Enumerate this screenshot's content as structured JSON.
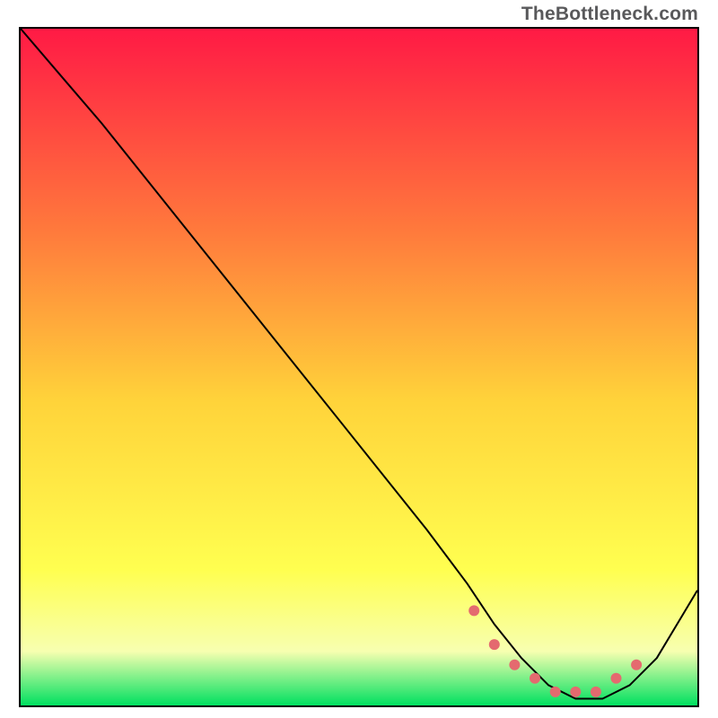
{
  "attribution": "TheBottleneck.com",
  "colors": {
    "gradient_top": "#ff1a45",
    "gradient_mid_upper": "#ff7a3c",
    "gradient_mid": "#ffd33a",
    "gradient_mid_lower": "#ffff50",
    "gradient_lower": "#f7ffb0",
    "gradient_bottom": "#00e060",
    "curve": "#000000",
    "marker": "#e46a6f",
    "border": "#000000"
  },
  "chart_data": {
    "type": "line",
    "title": "",
    "xlabel": "",
    "ylabel": "",
    "xlim": [
      0,
      100
    ],
    "ylim": [
      0,
      100
    ],
    "grid": false,
    "legend": false,
    "series": [
      {
        "name": "bottleneck-curve",
        "x": [
          0,
          6,
          12,
          20,
          28,
          36,
          44,
          52,
          60,
          66,
          70,
          74,
          78,
          82,
          86,
          90,
          94,
          100
        ],
        "values": [
          100,
          93,
          86,
          76,
          66,
          56,
          46,
          36,
          26,
          18,
          12,
          7,
          3,
          1,
          1,
          3,
          7,
          17
        ]
      }
    ],
    "highlight_range": {
      "name": "optimal-zone-markers",
      "x": [
        67,
        70,
        73,
        76,
        79,
        82,
        85,
        88,
        91
      ],
      "values": [
        14,
        9,
        6,
        4,
        2,
        2,
        2,
        4,
        6
      ]
    }
  }
}
